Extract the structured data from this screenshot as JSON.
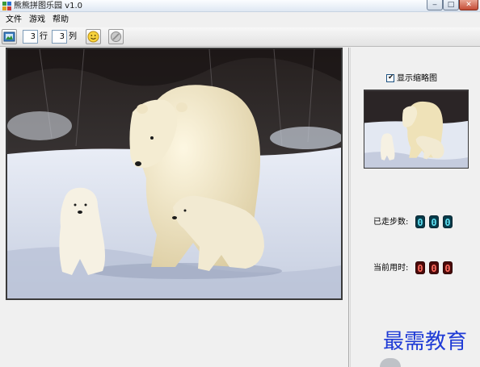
{
  "window": {
    "title": "熊熊拼图乐园 v1.0",
    "controls": {
      "minimize": "‒",
      "maximize": "□",
      "close": "✕"
    }
  },
  "menu": {
    "items": [
      "文件",
      "游戏",
      "帮助"
    ]
  },
  "toolbar": {
    "rows_value": "3",
    "rows_label": "行",
    "cols_value": "3",
    "cols_label": "列",
    "icons": [
      "open-image-icon",
      "smiley-icon",
      "stop-icon"
    ]
  },
  "puzzle": {
    "image": "polar-bear-family",
    "rows": 3,
    "cols": 3
  },
  "sidebar": {
    "thumbnail_toggle_label": "显示缩略图",
    "thumbnail_checked": true,
    "steps_label": "已走步数:",
    "steps_digits": [
      "0",
      "0",
      "0"
    ],
    "time_label": "当前用时:",
    "time_digits": [
      "0",
      "0",
      "0"
    ]
  },
  "watermark": "最需教育",
  "colors": {
    "steps_digit": "#5de0f2",
    "time_digit": "#ff6b5e",
    "watermark": "#1f3bd6"
  }
}
